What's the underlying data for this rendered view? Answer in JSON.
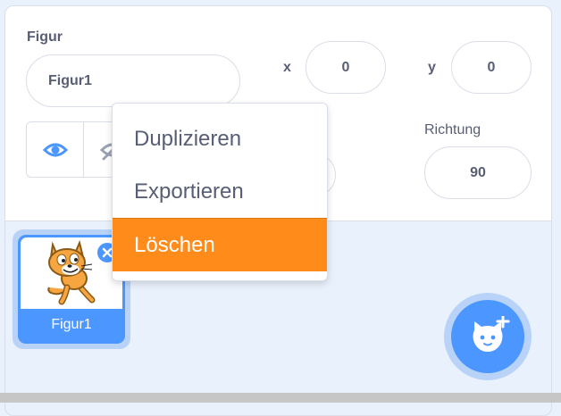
{
  "sprite_info": {
    "sprite_label": "Figur",
    "sprite_name_value": "Figur1",
    "x_label": "x",
    "x_value": "0",
    "y_label": "y",
    "y_value": "0",
    "direction_label": "Richtung",
    "direction_value": "90"
  },
  "context_menu": {
    "items": [
      "Duplizieren",
      "Exportieren",
      "Löschen"
    ],
    "danger_color": "#ff8c1a"
  },
  "sprite_list": {
    "items": [
      {
        "name": "Figur1",
        "selected": true
      }
    ]
  },
  "icons": {
    "show": "eye-icon",
    "hide": "eye-slash-icon",
    "delete": "close-icon",
    "add_sprite": "cat-plus-icon"
  },
  "colors": {
    "accent": "#4c97ff",
    "accent_light": "#b8d3f7",
    "text": "#575e75",
    "panel_bg": "#e9f1fc"
  }
}
